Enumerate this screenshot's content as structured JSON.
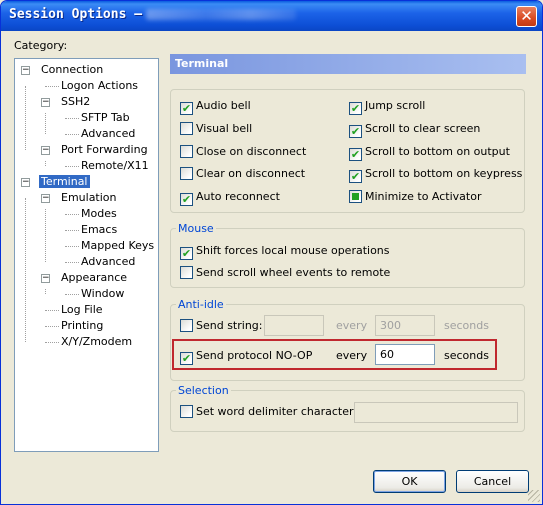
{
  "window": {
    "title": "Session Options —",
    "close_glyph": "✕"
  },
  "category_label": "Category:",
  "tree": [
    {
      "id": "connection",
      "label": "Connection"
    },
    {
      "id": "logon-actions",
      "label": "Logon Actions"
    },
    {
      "id": "ssh2",
      "label": "SSH2"
    },
    {
      "id": "sftp-tab",
      "label": "SFTP Tab"
    },
    {
      "id": "ssh2-advanced",
      "label": "Advanced"
    },
    {
      "id": "port-forwarding",
      "label": "Port Forwarding"
    },
    {
      "id": "remote-x11",
      "label": "Remote/X11"
    },
    {
      "id": "terminal",
      "label": "Terminal",
      "selected": true
    },
    {
      "id": "emulation",
      "label": "Emulation"
    },
    {
      "id": "modes",
      "label": "Modes"
    },
    {
      "id": "emacs",
      "label": "Emacs"
    },
    {
      "id": "mapped-keys",
      "label": "Mapped Keys"
    },
    {
      "id": "emulation-advanced",
      "label": "Advanced"
    },
    {
      "id": "appearance",
      "label": "Appearance"
    },
    {
      "id": "window",
      "label": "Window"
    },
    {
      "id": "log-file",
      "label": "Log File"
    },
    {
      "id": "printing",
      "label": "Printing"
    },
    {
      "id": "xyzmodem",
      "label": "X/Y/Zmodem"
    }
  ],
  "panel_title": "Terminal",
  "terminal_options": {
    "audio_bell": {
      "label": "Audio bell",
      "checked": true
    },
    "visual_bell": {
      "label": "Visual bell",
      "checked": false
    },
    "close_on_disconnect": {
      "label": "Close on disconnect",
      "checked": false
    },
    "clear_on_disconnect": {
      "label": "Clear on disconnect",
      "checked": false
    },
    "auto_reconnect": {
      "label": "Auto reconnect",
      "checked": true
    },
    "jump_scroll": {
      "label": "Jump scroll",
      "checked": true
    },
    "scroll_to_clear_screen": {
      "label": "Scroll to clear screen",
      "checked": true
    },
    "scroll_to_bottom_output": {
      "label": "Scroll to bottom on output",
      "checked": true
    },
    "scroll_to_bottom_keypress": {
      "label": "Scroll to bottom on keypress",
      "checked": true
    },
    "minimize_to_activator": {
      "label": "Minimize to Activator",
      "checked": true,
      "indeterminate": true
    }
  },
  "mouse": {
    "title": "Mouse",
    "shift_forces": {
      "label": "Shift forces local mouse operations",
      "checked": true
    },
    "scroll_wheel_remote": {
      "label": "Send scroll wheel events to remote",
      "checked": false
    }
  },
  "anti_idle": {
    "title": "Anti-idle",
    "send_string": {
      "label": "Send string:",
      "checked": false,
      "value": "",
      "every_label": "every",
      "interval": "300",
      "unit": "seconds"
    },
    "send_noop": {
      "label": "Send protocol NO-OP",
      "checked": true,
      "every_label": "every",
      "interval": "60",
      "unit": "seconds"
    }
  },
  "selection": {
    "title": "Selection",
    "word_delimiter": {
      "label": "Set word delimiter characters:",
      "checked": false,
      "value": ""
    }
  },
  "buttons": {
    "ok": "OK",
    "cancel": "Cancel"
  },
  "colors": {
    "title_bar": "#0a5ce0",
    "panel_header": "#7a96df",
    "group_title": "#0046d5",
    "highlight": "#c0282e",
    "check": "#21a121"
  }
}
